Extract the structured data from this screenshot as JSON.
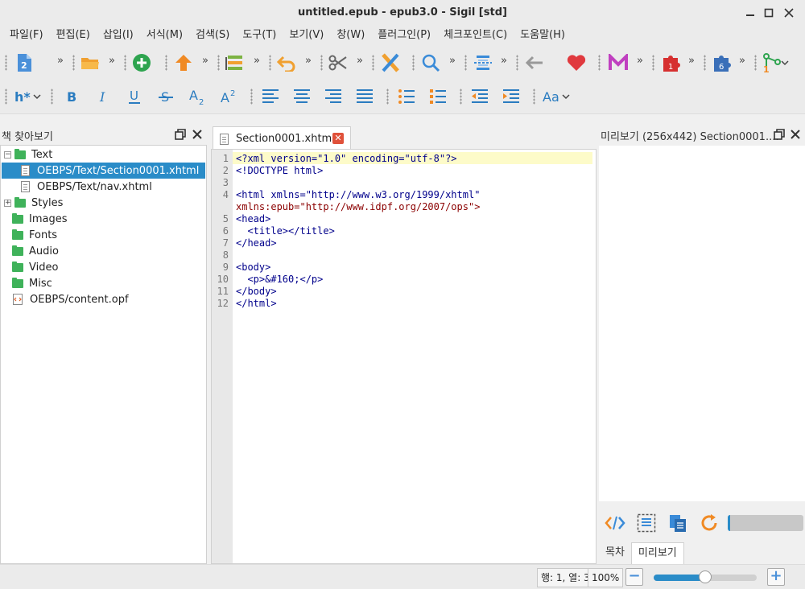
{
  "window": {
    "title": "untitled.epub - epub3.0 - Sigil [std]"
  },
  "menu": [
    "파일(F)",
    "편집(E)",
    "삽입(I)",
    "서식(M)",
    "검색(S)",
    "도구(T)",
    "보기(V)",
    "창(W)",
    "플러그인(P)",
    "체크포인트(C)",
    "도움말(H)"
  ],
  "toolbar": {
    "more_glyph": "»",
    "heading_label": "h*",
    "case_label": "Aa",
    "plugin1_badge": "1",
    "plugin2_badge": "6",
    "plugin3_badge": "1"
  },
  "book_browser": {
    "title": "책 찾아보기",
    "items": [
      {
        "label": "Text",
        "type": "folder",
        "expander": "−"
      },
      {
        "label": "OEBPS/Text/Section0001.xhtml",
        "type": "file",
        "selected": true
      },
      {
        "label": "OEBPS/Text/nav.xhtml",
        "type": "file"
      },
      {
        "label": "Styles",
        "type": "folder",
        "expander": "+"
      },
      {
        "label": "Images",
        "type": "folder"
      },
      {
        "label": "Fonts",
        "type": "folder"
      },
      {
        "label": "Audio",
        "type": "folder"
      },
      {
        "label": "Video",
        "type": "folder"
      },
      {
        "label": "Misc",
        "type": "folder"
      },
      {
        "label": "OEBPS/content.opf",
        "type": "opf"
      }
    ]
  },
  "editor": {
    "tab_label": "Section0001.xhtml",
    "line_numbers": [
      "1",
      "2",
      "3",
      "4",
      "",
      "5",
      "6",
      "7",
      "8",
      "9",
      "10",
      "11",
      "12"
    ],
    "lines": [
      "<?xml version=\"1.0\" encoding=\"utf-8\"?>",
      "<!DOCTYPE html>",
      "",
      "<html xmlns=\"http://www.w3.org/1999/xhtml\"",
      "xmlns:epub=\"http://www.idpf.org/2007/ops\">",
      "<head>",
      "  <title></title>",
      "</head>",
      "",
      "<body>",
      "  <p>&#160;</p>",
      "</body>",
      "</html>"
    ]
  },
  "preview": {
    "title": "미리보기 (256x442) Section0001....",
    "progress_fraction": 0.03,
    "tabs": [
      "목차",
      "미리보기"
    ]
  },
  "status": {
    "position": "행: 1, 열: 3",
    "zoom": "100%",
    "zoom_out": "−",
    "zoom_in": "+",
    "zoom_level": 0.5
  },
  "colors": {
    "accent": "#2a8cc8",
    "folder": "#3fb25a",
    "tab_close": "#e0513a"
  }
}
